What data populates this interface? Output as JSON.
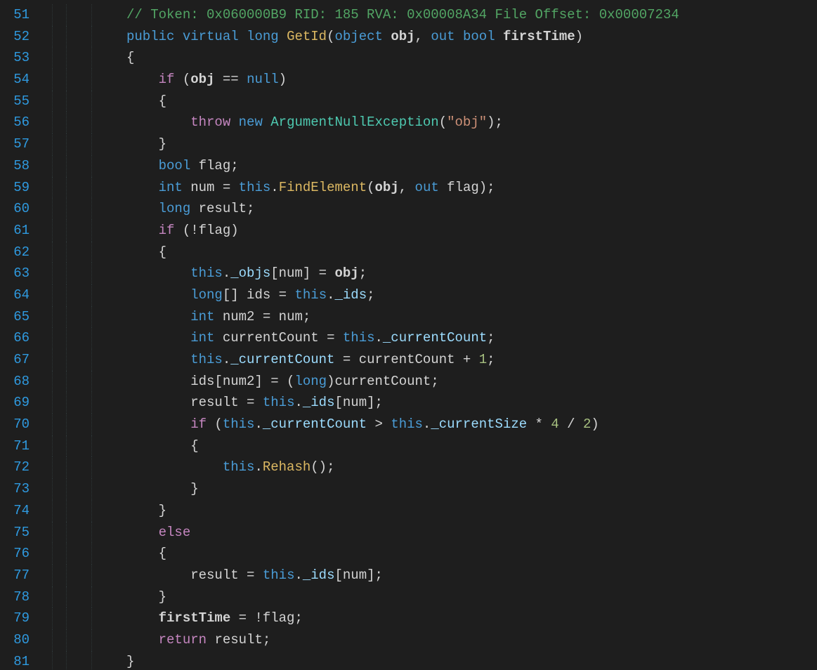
{
  "editor": {
    "first_line": 51,
    "last_line": 81,
    "lines": {
      "51": {
        "indent": 3,
        "tokens": [
          {
            "t": "// Token: 0x060000B9 RID: 185 RVA: 0x00008A34 File Offset: 0x00007234",
            "c": "c-comment"
          }
        ]
      },
      "52": {
        "indent": 3,
        "tokens": [
          {
            "t": "public",
            "c": "c-keyword"
          },
          {
            "t": " "
          },
          {
            "t": "virtual",
            "c": "c-keyword"
          },
          {
            "t": " "
          },
          {
            "t": "long",
            "c": "c-keyword"
          },
          {
            "t": " "
          },
          {
            "t": "GetId",
            "c": "c-method"
          },
          {
            "t": "(",
            "c": "c-op"
          },
          {
            "t": "object",
            "c": "c-keyword"
          },
          {
            "t": " "
          },
          {
            "t": "obj",
            "c": "c-param"
          },
          {
            "t": ", ",
            "c": "c-op"
          },
          {
            "t": "out",
            "c": "c-keyword"
          },
          {
            "t": " "
          },
          {
            "t": "bool",
            "c": "c-keyword"
          },
          {
            "t": " "
          },
          {
            "t": "firstTime",
            "c": "c-param"
          },
          {
            "t": ")",
            "c": "c-op"
          }
        ]
      },
      "53": {
        "indent": 3,
        "tokens": [
          {
            "t": "{",
            "c": "c-brace"
          }
        ]
      },
      "54": {
        "indent": 4,
        "tokens": [
          {
            "t": "if",
            "c": "c-control"
          },
          {
            "t": " (",
            "c": "c-op"
          },
          {
            "t": "obj",
            "c": "c-param"
          },
          {
            "t": " == ",
            "c": "c-op"
          },
          {
            "t": "null",
            "c": "c-keyword"
          },
          {
            "t": ")",
            "c": "c-op"
          }
        ]
      },
      "55": {
        "indent": 4,
        "tokens": [
          {
            "t": "{",
            "c": "c-brace"
          }
        ]
      },
      "56": {
        "indent": 5,
        "tokens": [
          {
            "t": "throw",
            "c": "c-control"
          },
          {
            "t": " "
          },
          {
            "t": "new",
            "c": "c-keyword"
          },
          {
            "t": " "
          },
          {
            "t": "ArgumentNullException",
            "c": "c-type"
          },
          {
            "t": "(",
            "c": "c-op"
          },
          {
            "t": "\"obj\"",
            "c": "c-string"
          },
          {
            "t": ");",
            "c": "c-op"
          }
        ]
      },
      "57": {
        "indent": 4,
        "tokens": [
          {
            "t": "}",
            "c": "c-brace"
          }
        ]
      },
      "58": {
        "indent": 4,
        "tokens": [
          {
            "t": "bool",
            "c": "c-keyword"
          },
          {
            "t": " "
          },
          {
            "t": "flag",
            "c": "c-ident"
          },
          {
            "t": ";",
            "c": "c-op"
          }
        ]
      },
      "59": {
        "indent": 4,
        "tokens": [
          {
            "t": "int",
            "c": "c-keyword"
          },
          {
            "t": " "
          },
          {
            "t": "num",
            "c": "c-ident"
          },
          {
            "t": " = ",
            "c": "c-op"
          },
          {
            "t": "this",
            "c": "c-keyword"
          },
          {
            "t": ".",
            "c": "c-op"
          },
          {
            "t": "FindElement",
            "c": "c-method"
          },
          {
            "t": "(",
            "c": "c-op"
          },
          {
            "t": "obj",
            "c": "c-param"
          },
          {
            "t": ", ",
            "c": "c-op"
          },
          {
            "t": "out",
            "c": "c-keyword"
          },
          {
            "t": " "
          },
          {
            "t": "flag",
            "c": "c-ident"
          },
          {
            "t": ");",
            "c": "c-op"
          }
        ]
      },
      "60": {
        "indent": 4,
        "tokens": [
          {
            "t": "long",
            "c": "c-keyword"
          },
          {
            "t": " "
          },
          {
            "t": "result",
            "c": "c-ident"
          },
          {
            "t": ";",
            "c": "c-op"
          }
        ]
      },
      "61": {
        "indent": 4,
        "tokens": [
          {
            "t": "if",
            "c": "c-control"
          },
          {
            "t": " (!",
            "c": "c-op"
          },
          {
            "t": "flag",
            "c": "c-ident"
          },
          {
            "t": ")",
            "c": "c-op"
          }
        ]
      },
      "62": {
        "indent": 4,
        "tokens": [
          {
            "t": "{",
            "c": "c-brace"
          }
        ]
      },
      "63": {
        "indent": 5,
        "tokens": [
          {
            "t": "this",
            "c": "c-keyword"
          },
          {
            "t": ".",
            "c": "c-op"
          },
          {
            "t": "_objs",
            "c": "c-field"
          },
          {
            "t": "[",
            "c": "c-op"
          },
          {
            "t": "num",
            "c": "c-ident"
          },
          {
            "t": "] = ",
            "c": "c-op"
          },
          {
            "t": "obj",
            "c": "c-param"
          },
          {
            "t": ";",
            "c": "c-op"
          }
        ]
      },
      "64": {
        "indent": 5,
        "tokens": [
          {
            "t": "long",
            "c": "c-keyword"
          },
          {
            "t": "[] ",
            "c": "c-op"
          },
          {
            "t": "ids",
            "c": "c-ident"
          },
          {
            "t": " = ",
            "c": "c-op"
          },
          {
            "t": "this",
            "c": "c-keyword"
          },
          {
            "t": ".",
            "c": "c-op"
          },
          {
            "t": "_ids",
            "c": "c-field"
          },
          {
            "t": ";",
            "c": "c-op"
          }
        ]
      },
      "65": {
        "indent": 5,
        "tokens": [
          {
            "t": "int",
            "c": "c-keyword"
          },
          {
            "t": " "
          },
          {
            "t": "num2",
            "c": "c-ident"
          },
          {
            "t": " = ",
            "c": "c-op"
          },
          {
            "t": "num",
            "c": "c-ident"
          },
          {
            "t": ";",
            "c": "c-op"
          }
        ]
      },
      "66": {
        "indent": 5,
        "tokens": [
          {
            "t": "int",
            "c": "c-keyword"
          },
          {
            "t": " "
          },
          {
            "t": "currentCount",
            "c": "c-ident"
          },
          {
            "t": " = ",
            "c": "c-op"
          },
          {
            "t": "this",
            "c": "c-keyword"
          },
          {
            "t": ".",
            "c": "c-op"
          },
          {
            "t": "_currentCount",
            "c": "c-field"
          },
          {
            "t": ";",
            "c": "c-op"
          }
        ]
      },
      "67": {
        "indent": 5,
        "tokens": [
          {
            "t": "this",
            "c": "c-keyword"
          },
          {
            "t": ".",
            "c": "c-op"
          },
          {
            "t": "_currentCount",
            "c": "c-field"
          },
          {
            "t": " = ",
            "c": "c-op"
          },
          {
            "t": "currentCount",
            "c": "c-ident"
          },
          {
            "t": " + ",
            "c": "c-op"
          },
          {
            "t": "1",
            "c": "c-number"
          },
          {
            "t": ";",
            "c": "c-op"
          }
        ]
      },
      "68": {
        "indent": 5,
        "tokens": [
          {
            "t": "ids",
            "c": "c-ident"
          },
          {
            "t": "[",
            "c": "c-op"
          },
          {
            "t": "num2",
            "c": "c-ident"
          },
          {
            "t": "] = (",
            "c": "c-op"
          },
          {
            "t": "long",
            "c": "c-keyword"
          },
          {
            "t": ")",
            "c": "c-op"
          },
          {
            "t": "currentCount",
            "c": "c-ident"
          },
          {
            "t": ";",
            "c": "c-op"
          }
        ]
      },
      "69": {
        "indent": 5,
        "tokens": [
          {
            "t": "result",
            "c": "c-ident"
          },
          {
            "t": " = ",
            "c": "c-op"
          },
          {
            "t": "this",
            "c": "c-keyword"
          },
          {
            "t": ".",
            "c": "c-op"
          },
          {
            "t": "_ids",
            "c": "c-field"
          },
          {
            "t": "[",
            "c": "c-op"
          },
          {
            "t": "num",
            "c": "c-ident"
          },
          {
            "t": "];",
            "c": "c-op"
          }
        ]
      },
      "70": {
        "indent": 5,
        "tokens": [
          {
            "t": "if",
            "c": "c-control"
          },
          {
            "t": " (",
            "c": "c-op"
          },
          {
            "t": "this",
            "c": "c-keyword"
          },
          {
            "t": ".",
            "c": "c-op"
          },
          {
            "t": "_currentCount",
            "c": "c-field"
          },
          {
            "t": " > ",
            "c": "c-op"
          },
          {
            "t": "this",
            "c": "c-keyword"
          },
          {
            "t": ".",
            "c": "c-op"
          },
          {
            "t": "_currentSize",
            "c": "c-field"
          },
          {
            "t": " * ",
            "c": "c-op"
          },
          {
            "t": "4",
            "c": "c-number"
          },
          {
            "t": " / ",
            "c": "c-op"
          },
          {
            "t": "2",
            "c": "c-number"
          },
          {
            "t": ")",
            "c": "c-op"
          }
        ]
      },
      "71": {
        "indent": 5,
        "tokens": [
          {
            "t": "{",
            "c": "c-brace"
          }
        ]
      },
      "72": {
        "indent": 6,
        "tokens": [
          {
            "t": "this",
            "c": "c-keyword"
          },
          {
            "t": ".",
            "c": "c-op"
          },
          {
            "t": "Rehash",
            "c": "c-method"
          },
          {
            "t": "();",
            "c": "c-op"
          }
        ]
      },
      "73": {
        "indent": 5,
        "tokens": [
          {
            "t": "}",
            "c": "c-brace"
          }
        ]
      },
      "74": {
        "indent": 4,
        "tokens": [
          {
            "t": "}",
            "c": "c-brace"
          }
        ]
      },
      "75": {
        "indent": 4,
        "tokens": [
          {
            "t": "else",
            "c": "c-control"
          }
        ]
      },
      "76": {
        "indent": 4,
        "tokens": [
          {
            "t": "{",
            "c": "c-brace"
          }
        ]
      },
      "77": {
        "indent": 5,
        "tokens": [
          {
            "t": "result",
            "c": "c-ident"
          },
          {
            "t": " = ",
            "c": "c-op"
          },
          {
            "t": "this",
            "c": "c-keyword"
          },
          {
            "t": ".",
            "c": "c-op"
          },
          {
            "t": "_ids",
            "c": "c-field"
          },
          {
            "t": "[",
            "c": "c-op"
          },
          {
            "t": "num",
            "c": "c-ident"
          },
          {
            "t": "];",
            "c": "c-op"
          }
        ]
      },
      "78": {
        "indent": 4,
        "tokens": [
          {
            "t": "}",
            "c": "c-brace"
          }
        ]
      },
      "79": {
        "indent": 4,
        "tokens": [
          {
            "t": "firstTime",
            "c": "c-param"
          },
          {
            "t": " = !",
            "c": "c-op"
          },
          {
            "t": "flag",
            "c": "c-ident"
          },
          {
            "t": ";",
            "c": "c-op"
          }
        ]
      },
      "80": {
        "indent": 4,
        "tokens": [
          {
            "t": "return",
            "c": "c-control"
          },
          {
            "t": " "
          },
          {
            "t": "result",
            "c": "c-ident"
          },
          {
            "t": ";",
            "c": "c-op"
          }
        ]
      },
      "81": {
        "indent": 3,
        "tokens": [
          {
            "t": "}",
            "c": "c-brace"
          }
        ]
      }
    }
  }
}
